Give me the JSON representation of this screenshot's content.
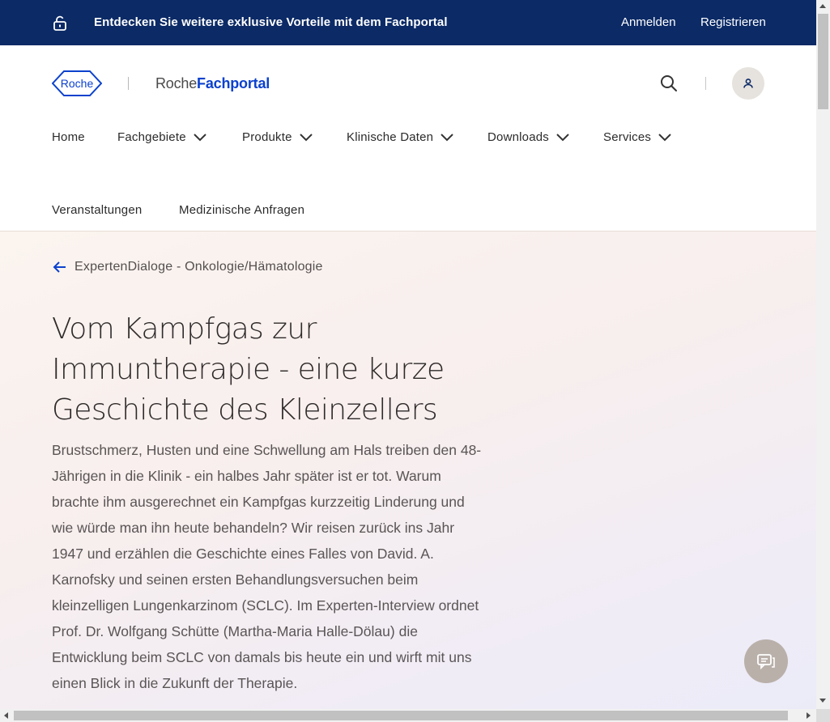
{
  "banner": {
    "promo_text": "Entdecken Sie weitere exklusive Vorteile mit dem Fachportal",
    "login_label": "Anmelden",
    "register_label": "Registrieren",
    "icon": "unlock-icon"
  },
  "header": {
    "logo_text": "Roche",
    "brand_prefix": "Roche",
    "brand_suffix": "Fachportal",
    "search_icon": "search-icon",
    "account_icon": "user-icon"
  },
  "nav": {
    "items": [
      {
        "label": "Home",
        "has_dropdown": false
      },
      {
        "label": "Fachgebiete",
        "has_dropdown": true
      },
      {
        "label": "Produkte",
        "has_dropdown": true
      },
      {
        "label": "Klinische Daten",
        "has_dropdown": true
      },
      {
        "label": "Downloads",
        "has_dropdown": true
      },
      {
        "label": "Services",
        "has_dropdown": true
      },
      {
        "label": "Veranstaltungen",
        "has_dropdown": false
      },
      {
        "label": "Medizinische Anfragen",
        "has_dropdown": false
      }
    ]
  },
  "article": {
    "breadcrumb": "ExpertenDialoge - Onkologie/Hämatologie",
    "title": "Vom Kampfgas zur Immuntherapie - eine kurze Geschichte des Kleinzellers",
    "intro": "Brustschmerz, Husten und eine Schwellung am Hals treiben den 48-Jährigen in die Klinik - ein halbes Jahr später ist er tot. Warum brachte ihm ausgerechnet ein Kampfgas kurzzeitig Linderung und wie würde man ihn heute behandeln? Wir reisen zurück ins Jahr 1947 und erzählen die Geschichte eines Falles von David. A. Karnofsky und seinen ersten Behandlungsversuchen beim kleinzelligen Lungenkarzinom (SCLC). Im Experten-Interview ordnet Prof. Dr. Wolfgang Schütte (Martha-Maria Halle-Dölau) die Entwicklung beim SCLC von damals bis heute ein und wirft mit uns einen Blick in die Zukunft der Therapie."
  },
  "colors": {
    "banner_bg": "#0b2a66",
    "brand_blue": "#0b41cd",
    "text": "#2e2a2a"
  }
}
